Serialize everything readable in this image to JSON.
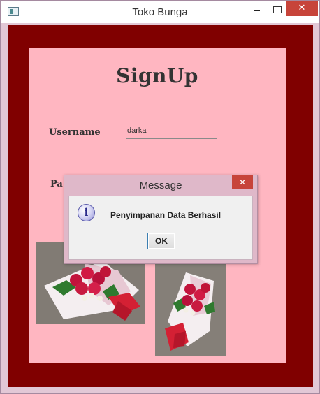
{
  "window": {
    "title": "Toko Bunga",
    "close_glyph": "✕"
  },
  "signup": {
    "title": "SignUp",
    "username_label": "Username",
    "username_value": "darka",
    "password_label_visible": "Pa"
  },
  "dialog": {
    "title": "Message",
    "close_glyph": "✕",
    "icon_glyph": "i",
    "message": "Penyimpanan Data Berhasil",
    "ok_label": "OK"
  },
  "images": {
    "left": "red-rose-bouquet-photo",
    "right": "red-rose-bouquet-photo"
  },
  "colors": {
    "frame": "#800000",
    "panel": "#ffb6c1",
    "close": "#c7443a"
  }
}
